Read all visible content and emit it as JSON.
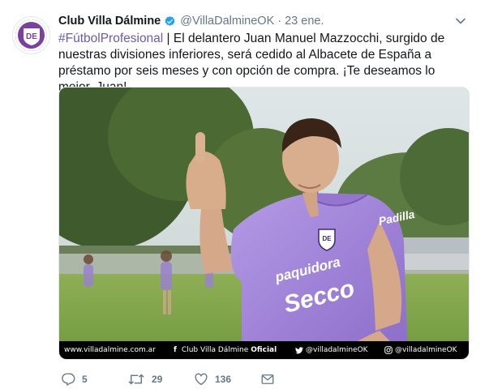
{
  "tweet": {
    "name": "Club Villa Dálmine",
    "handle": "@VillaDalmineOK",
    "separator": "·",
    "date": "23 ene.",
    "hashtag": "#FútbolProfesional",
    "body": " | El delantero Juan Manuel Mazzocchi, surgido de nuestras divisiones inferiores, será cedido al Albacete de España a préstamo por seis meses y con opción de compra. ¡Te deseamos lo mejor, Juan!",
    "avatar_letters": "DE"
  },
  "media": {
    "footer_url": "www.villadalmine.com.ar",
    "footer_club": "Club Villa Dálmine",
    "footer_club_bold": "Oficial",
    "footer_twitter": "@villadalmineOK",
    "footer_instagram": "@villadalmineOK",
    "shirt_sponsor_1": "paquidora",
    "shirt_sponsor_2": "Secco",
    "shirt_brand": "Padilla",
    "crest_letters": "DE"
  },
  "actions": {
    "replies": "5",
    "retweets": "29",
    "likes": "136"
  },
  "colors": {
    "hashtag": "#6b5bb8",
    "verified": "#1da1f2",
    "jersey": "#9b7fd8",
    "meta": "#657786"
  }
}
